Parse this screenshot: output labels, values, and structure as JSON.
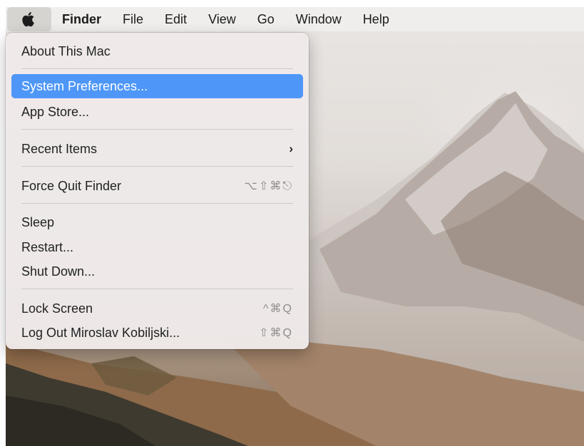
{
  "menubar": {
    "apple_icon": "apple-logo-icon",
    "items": [
      "Finder",
      "File",
      "Edit",
      "View",
      "Go",
      "Window",
      "Help"
    ]
  },
  "apple_menu": {
    "about": "About This Mac",
    "system_prefs": "System Preferences...",
    "app_store": "App Store...",
    "recent_items": "Recent Items",
    "recent_items_icon": "chevron-right-icon",
    "recent_chevron": "›",
    "force_quit": "Force Quit Finder",
    "force_quit_shortcut": "⌥⇧⌘⎋",
    "sleep": "Sleep",
    "restart": "Restart...",
    "shut_down": "Shut Down...",
    "lock_screen": "Lock Screen",
    "lock_screen_shortcut": "^⌘Q",
    "log_out": "Log Out Miroslav Kobiljski...",
    "log_out_shortcut": "⇧⌘Q"
  },
  "colors": {
    "highlight": "#4e97f8",
    "menu_bg": "#eee9e9",
    "menubar_bg": "#efeeec"
  }
}
